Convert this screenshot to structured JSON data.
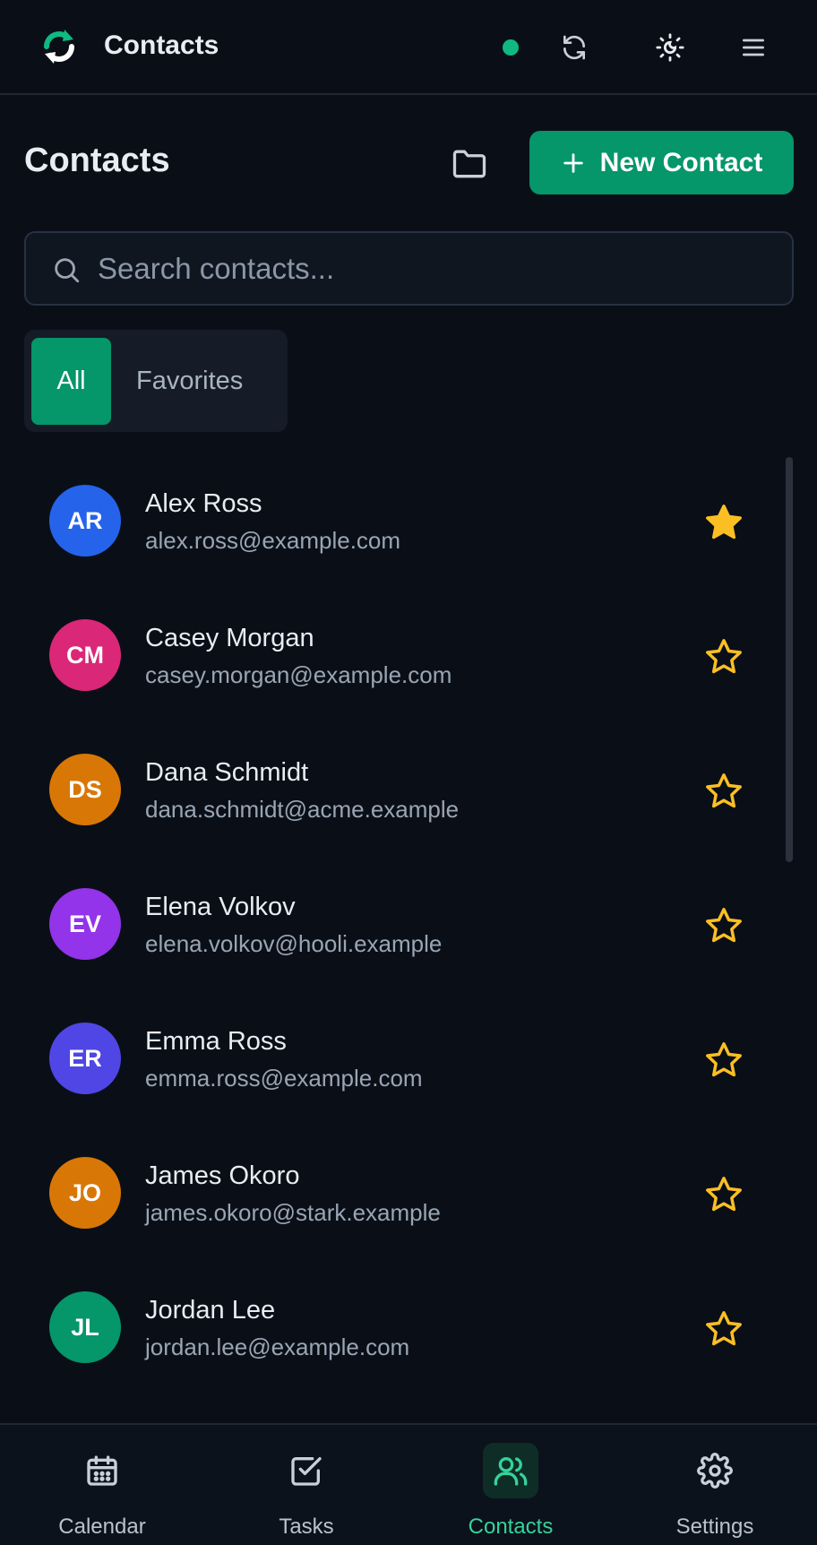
{
  "header": {
    "app_title": "Contacts"
  },
  "page": {
    "title": "Contacts",
    "new_contact_label": "New Contact"
  },
  "search": {
    "placeholder": "Search contacts...",
    "value": ""
  },
  "filters": {
    "all_label": "All",
    "favorites_label": "Favorites",
    "selected": "All"
  },
  "contacts": [
    {
      "initials": "AR",
      "name": "Alex Ross",
      "email": "alex.ross@example.com",
      "color": "#2563eb",
      "favorite": true
    },
    {
      "initials": "CM",
      "name": "Casey Morgan",
      "email": "casey.morgan@example.com",
      "color": "#db2777",
      "favorite": false
    },
    {
      "initials": "DS",
      "name": "Dana Schmidt",
      "email": "dana.schmidt@acme.example",
      "color": "#d97706",
      "favorite": false
    },
    {
      "initials": "EV",
      "name": "Elena Volkov",
      "email": "elena.volkov@hooli.example",
      "color": "#9333ea",
      "favorite": false
    },
    {
      "initials": "ER",
      "name": "Emma Ross",
      "email": "emma.ross@example.com",
      "color": "#4f46e5",
      "favorite": false
    },
    {
      "initials": "JO",
      "name": "James Okoro",
      "email": "james.okoro@stark.example",
      "color": "#d97706",
      "favorite": false
    },
    {
      "initials": "JL",
      "name": "Jordan Lee",
      "email": "jordan.lee@example.com",
      "color": "#059669",
      "favorite": false
    }
  ],
  "bottom_nav": {
    "items": [
      {
        "label": "Calendar",
        "icon": "calendar-icon"
      },
      {
        "label": "Tasks",
        "icon": "check-square-icon"
      },
      {
        "label": "Contacts",
        "icon": "users-icon"
      },
      {
        "label": "Settings",
        "icon": "gear-icon"
      }
    ],
    "active": "Contacts"
  },
  "colors": {
    "accent": "#059669",
    "accent_text": "#34d399",
    "star": "#fbbf24",
    "background": "#0a0f17"
  }
}
